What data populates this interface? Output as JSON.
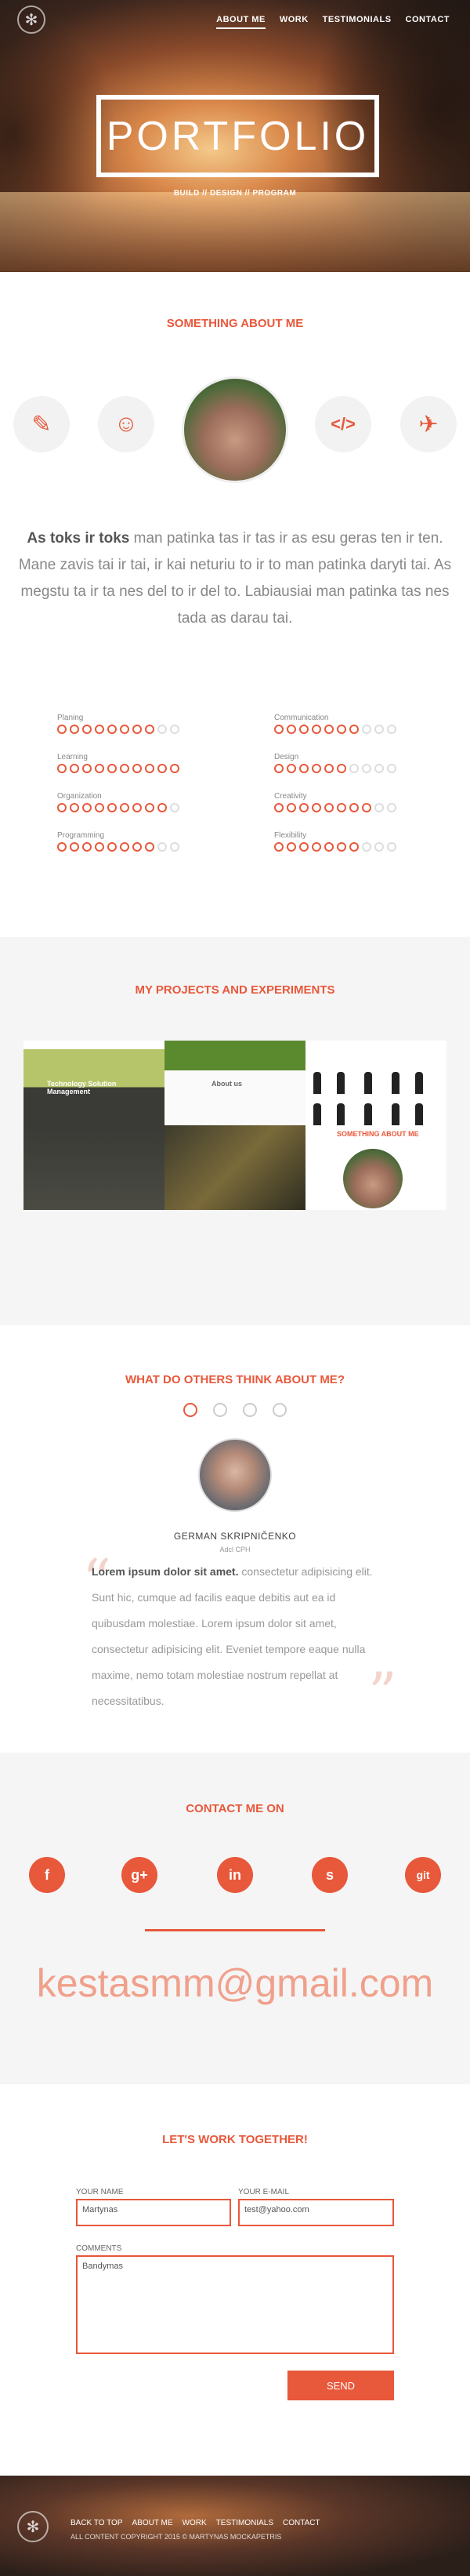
{
  "nav": {
    "items": [
      "ABOUT ME",
      "WORK",
      "TESTIMONIALS",
      "CONTACT"
    ]
  },
  "hero": {
    "title": "PORTFOLIO",
    "subtitle": "BUILD // DESIGN // PROGRAM"
  },
  "about": {
    "title": "SOMETHING ABOUT ME",
    "lead": "As toks ir toks",
    "text": " man patinka tas ir tas ir as esu geras ten ir ten. Mane zavis tai ir tai, ir kai neturiu to ir to man patinka daryti tai. As megstu ta ir ta nes del to ir del to. Labiausiai man patinka tas nes tada as darau tai.",
    "skills": [
      {
        "label": "Planing",
        "level": 8,
        "max": 10
      },
      {
        "label": "Communication",
        "level": 7,
        "max": 10
      },
      {
        "label": "Learning",
        "level": 10,
        "max": 10
      },
      {
        "label": "Design",
        "level": 6,
        "max": 10
      },
      {
        "label": "Organization",
        "level": 9,
        "max": 10
      },
      {
        "label": "Creativity",
        "level": 8,
        "max": 10
      },
      {
        "label": "Programming",
        "level": 8,
        "max": 10
      },
      {
        "label": "Flexibility",
        "level": 7,
        "max": 10
      }
    ]
  },
  "projects": {
    "title": "MY PROJECTS AND EXPERIMENTS",
    "tile1_caption": "Technology Solution Management",
    "tile2_caption": "About us",
    "tile6_caption": "SOMETHING ABOUT ME"
  },
  "testimonials": {
    "title": "WHAT DO OTHERS THINK ABOUT ME?",
    "name": "GERMAN SKRIPNIČENKO",
    "role": "Adcl CPH",
    "quote_lead": "Lorem ipsum dolor sit amet.",
    "quote": " consectetur adipisicing elit. Sunt hic, cumque ad facilis eaque debitis aut ea id quibusdam molestiae. Lorem ipsum dolor sit amet, consectetur adipisicing elit. Eveniet tempore eaque nulla maxime, nemo totam molestiae nostrum repellat at necessitatibus."
  },
  "contact": {
    "title": "CONTACT ME ON",
    "socials": [
      "f",
      "g+",
      "in",
      "s",
      "git"
    ],
    "email": "kestasmm@gmail.com"
  },
  "form": {
    "title": "LET'S WORK TOGETHER!",
    "name_label": "YOUR NAME",
    "name_value": "Martynas",
    "email_label": "YOUR E-MAIL",
    "email_value": "test@yahoo.com",
    "comments_label": "COMMENTS",
    "comments_value": "Bandymas",
    "send_label": "SEND"
  },
  "footer": {
    "items": [
      "BACK TO TOP",
      "ABOUT ME",
      "WORK",
      "TESTIMONIALS",
      "CONTACT"
    ],
    "copyright": "ALL CONTENT COPYRIGHT 2015 © MARTYNAS MOCKAPETRIS"
  },
  "colors": {
    "accent": "#e8583b"
  }
}
